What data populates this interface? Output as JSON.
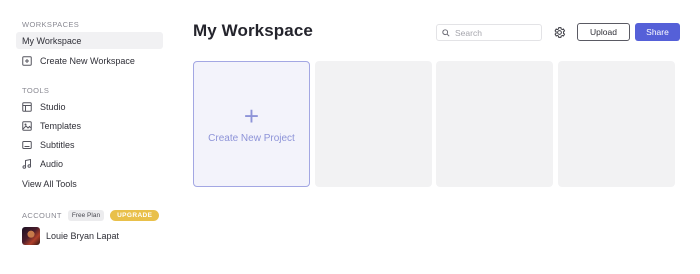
{
  "sidebar": {
    "workspaces_label": "WORKSPACES",
    "workspace_items": [
      {
        "label": "My Workspace",
        "icon": null
      },
      {
        "label": "Create New Workspace",
        "icon": "plus-square-icon"
      }
    ],
    "tools_label": "TOOLS",
    "tool_items": [
      {
        "label": "Studio",
        "icon": "layout-icon"
      },
      {
        "label": "Templates",
        "icon": "image-icon"
      },
      {
        "label": "Subtitles",
        "icon": "subtitles-icon"
      },
      {
        "label": "Audio",
        "icon": "music-note-icon"
      }
    ],
    "view_all_tools": "View All Tools",
    "account_label": "ACCOUNT",
    "plan_badge": "Free Plan",
    "upgrade_badge": "UPGRADE",
    "user_name": "Louie Bryan Lapat"
  },
  "header": {
    "title": "My Workspace",
    "search_placeholder": "Search",
    "upload_label": "Upload",
    "share_label": "Share"
  },
  "projects": {
    "create_new_label": "Create New Project",
    "create_new_symbol": "+"
  },
  "colors": {
    "accent": "#5560d8",
    "upgrade": "#e9c04a",
    "create_card_border": "#a3a7e3"
  }
}
